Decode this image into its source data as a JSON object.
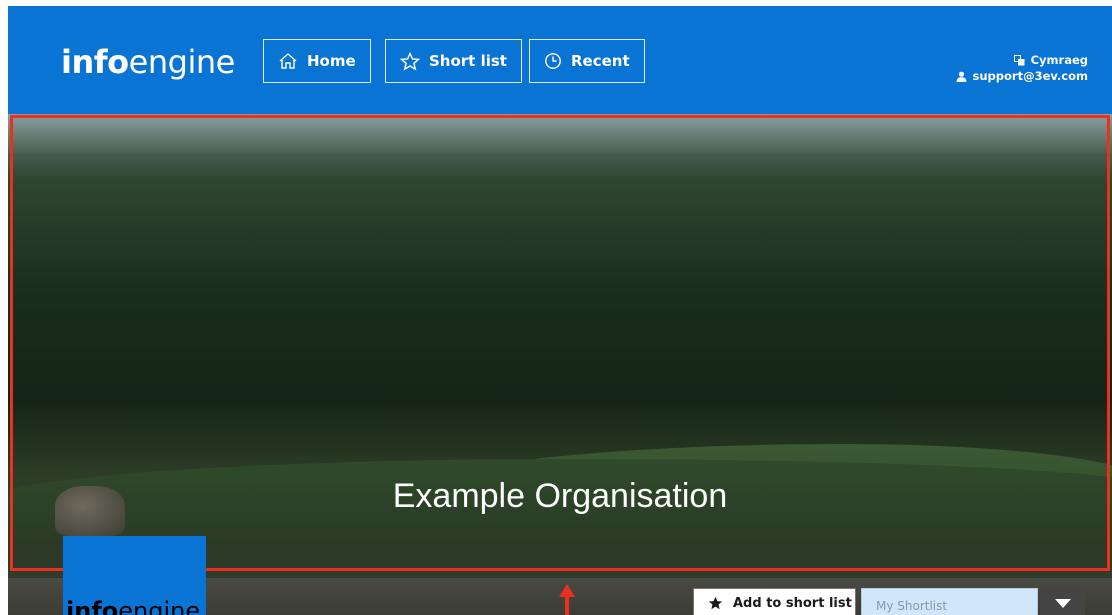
{
  "header": {
    "logo_bold": "info",
    "logo_light": "engine",
    "nav": [
      {
        "label": "Home",
        "icon": "home-icon"
      },
      {
        "label": "Short list",
        "icon": "star-icon"
      },
      {
        "label": "Recent",
        "icon": "clock-icon"
      }
    ],
    "language_link": "Cymraeg",
    "user_email": "support@3ev.com"
  },
  "hero": {
    "title": "Example Organisation"
  },
  "bottom": {
    "logo_bold": "info",
    "logo_light": "engine",
    "add_to_shortlist": "Add to short list",
    "shortlist_placeholder": "My Shortlist"
  },
  "colors": {
    "brand_blue": "#0a74d4",
    "annotation_red": "#e8321e",
    "shortlist_bg": "#cfe6fb"
  }
}
